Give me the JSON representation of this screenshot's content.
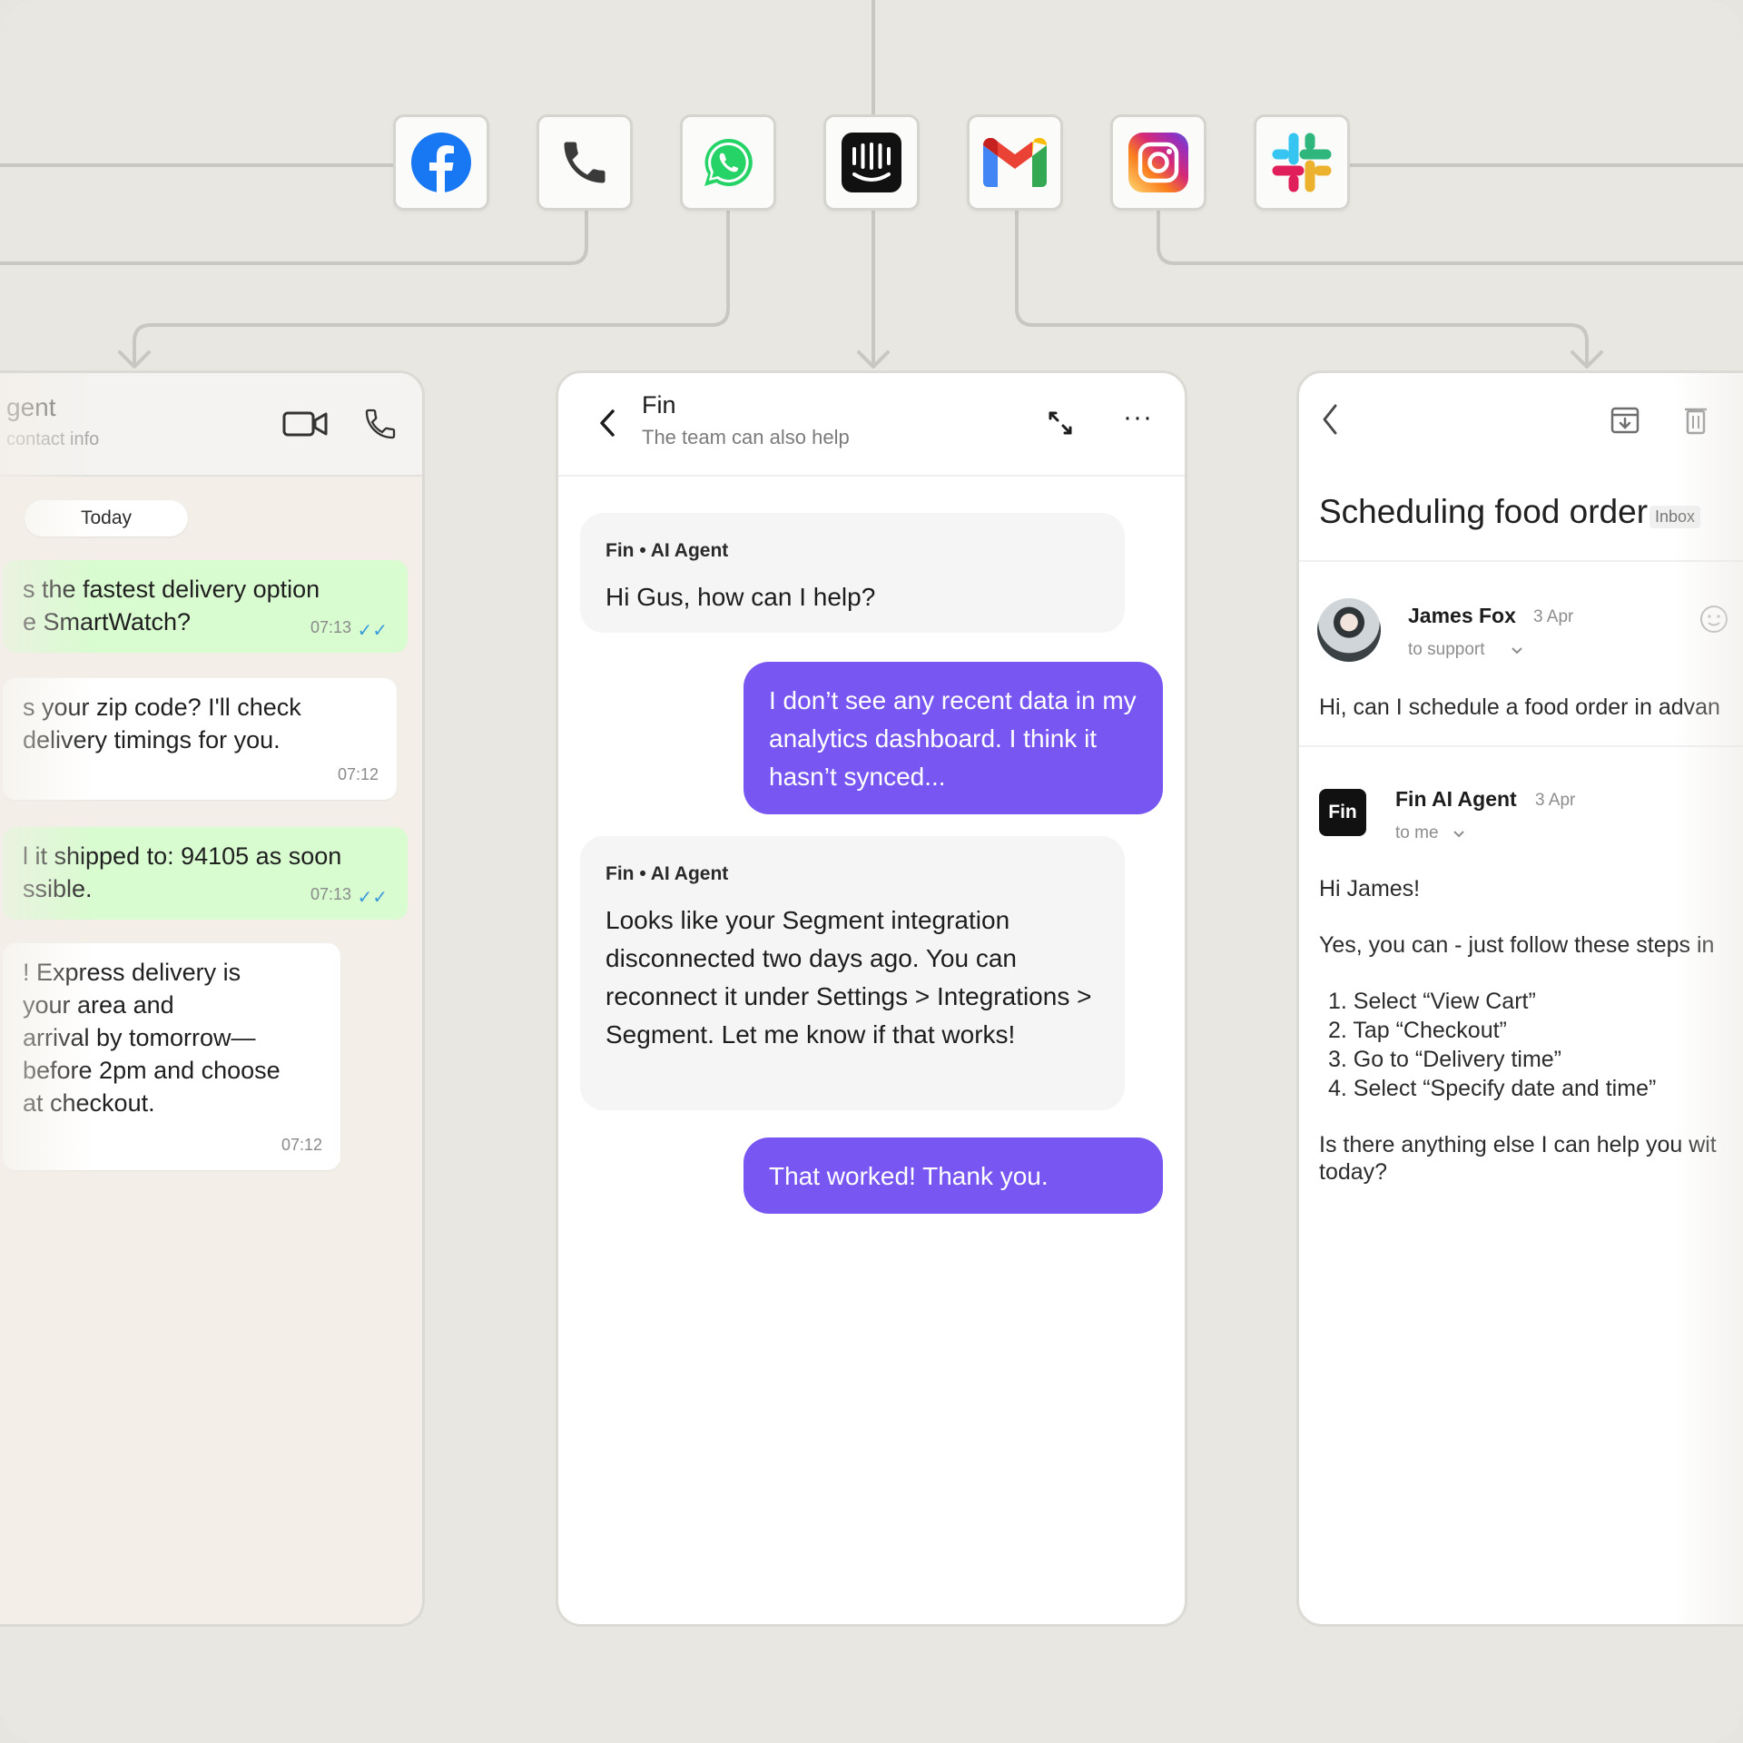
{
  "channels": [
    {
      "icon": "facebook-icon",
      "color": "#1877f2"
    },
    {
      "icon": "phone-icon",
      "color": "#333333"
    },
    {
      "icon": "whatsapp-icon",
      "color": "#25d366"
    },
    {
      "icon": "intercom-icon",
      "color": "#111111"
    },
    {
      "icon": "gmail-icon",
      "color": "#ea4335"
    },
    {
      "icon": "instagram-icon",
      "color": "#d62976"
    },
    {
      "icon": "slack-icon",
      "color": "#e01e5a"
    }
  ],
  "whatsapp": {
    "title": "gent",
    "subtitle": "contact info",
    "date_pill": "Today",
    "messages": [
      {
        "line1": "s the fastest delivery option",
        "line2": "e SmartWatch?",
        "time": "07:13"
      },
      {
        "line1": "s your zip code? I'll check",
        "line2": "delivery timings for you.",
        "time": "07:12"
      },
      {
        "line1": "l it shipped to: 94105 as soon",
        "line2": "ssible.",
        "time": "07:13"
      },
      {
        "line1": "! Express delivery is",
        "line2": "your area and",
        "line3": "arrival by tomorrow—",
        "line4": "before 2pm and choose",
        "line5": "at checkout.",
        "time": "07:12"
      }
    ]
  },
  "fin": {
    "name": "Fin",
    "subtitle": "The team can also help",
    "agent_label": "Fin • AI Agent",
    "ai_msg_1": "Hi Gus, how can I help?",
    "user_msg_1": "I don’t see any recent data in my analytics dashboard. I think it hasn’t synced...",
    "ai_msg_2": "Looks like your Segment integration disconnected two days ago. You can reconnect it under Settings > Integrations > Segment. Let me know if that works!",
    "user_msg_2": "That worked! Thank you.",
    "accent": "#7756f2"
  },
  "email": {
    "subject": "Scheduling food order",
    "label": "Inbox",
    "msg1": {
      "sender": "James Fox",
      "date": "3 Apr",
      "to": "to support",
      "preview": "Hi, can I schedule a food order in advan"
    },
    "msg2": {
      "sender": "Fin AI Agent",
      "date": "3 Apr",
      "to": "to me",
      "avatar_text": "Fin",
      "greeting": "Hi James!",
      "intro": "Yes, you can - just follow these steps in",
      "steps": [
        "1.  Select “View Cart”",
        "2.  Tap “Checkout”",
        "3.  Go to “Delivery time”",
        "4.  Select “Specify date and time”"
      ],
      "closing_1": "Is there anything else I can help you wit",
      "closing_2": "today?"
    }
  }
}
